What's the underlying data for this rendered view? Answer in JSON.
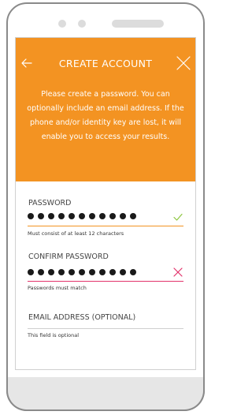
{
  "header": {
    "title": "CREATE ACCOUNT",
    "description": "Please create a password. You can optionally include an email address. If the phone and/or identity key are lost, it will enable you to access your results."
  },
  "icons": {
    "back": "arrow-left-icon",
    "close": "close-icon",
    "valid": "checkmark-icon",
    "invalid": "cross-icon"
  },
  "fields": {
    "password": {
      "label": "PASSWORD",
      "masked_length": 11,
      "helper": "Must consist of at least 12 characters",
      "status": "valid"
    },
    "confirm_password": {
      "label": "CONFIRM PASSWORD",
      "masked_length": 11,
      "helper": "Passwords must match",
      "status": "invalid"
    },
    "email": {
      "label": "EMAIL ADDRESS (OPTIONAL)",
      "value": "",
      "helper": "This field is optional"
    }
  },
  "colors": {
    "header_bg": "#f39322",
    "valid": "#8dc63f",
    "invalid": "#e2336b",
    "password_underline": "#f39322",
    "confirm_underline": "#e2336b",
    "email_underline": "#cfcfcf"
  }
}
